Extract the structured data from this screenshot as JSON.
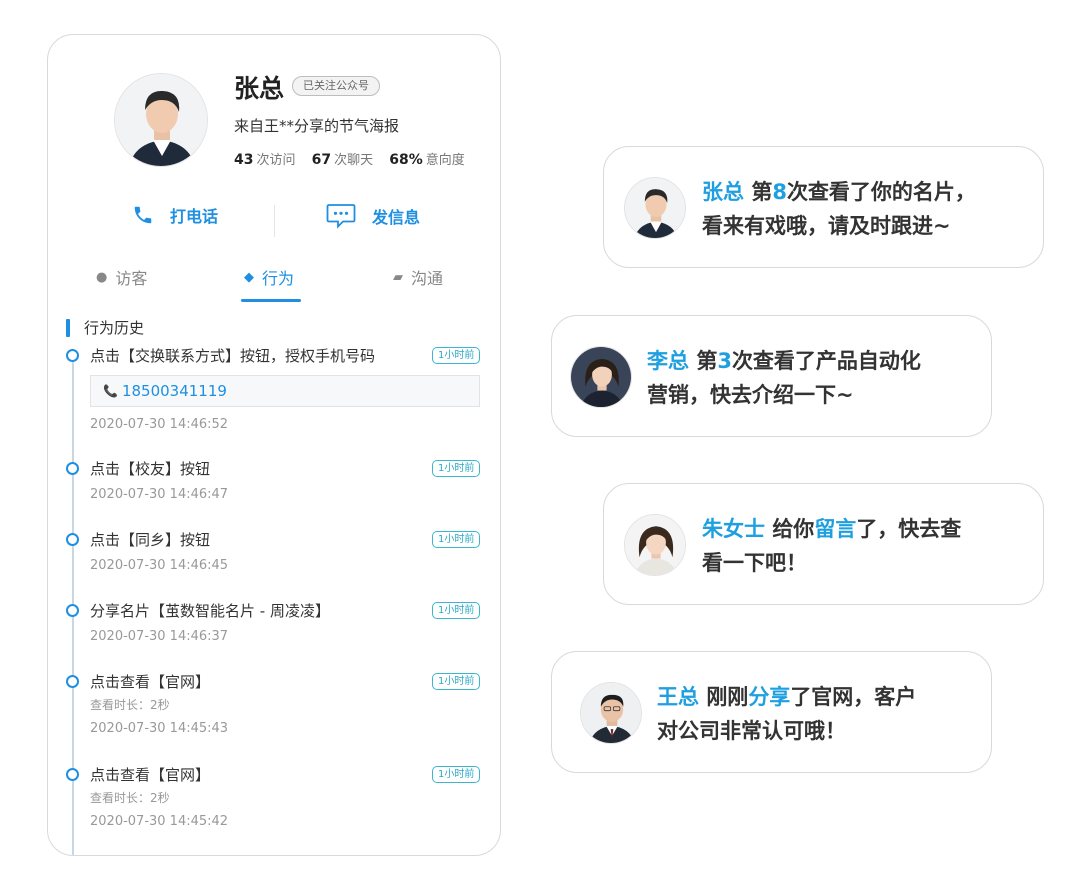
{
  "profile": {
    "name": "张总",
    "follow_badge": "已关注公众号",
    "source": "来自王**分享的节气海报",
    "visits_value": "43",
    "visits_label": "次访问",
    "chats_value": "67",
    "chats_label": "次聊天",
    "intent_value": "68%",
    "intent_label": "意向度"
  },
  "actions": {
    "call_label": "打电话",
    "message_label": "发信息"
  },
  "tabs": [
    {
      "label": "访客"
    },
    {
      "label": "行为"
    },
    {
      "label": "沟通"
    }
  ],
  "active_tab": "行为",
  "section_title": "行为历史",
  "events": [
    {
      "title": "点击【交换联系方式】按钮，授权手机号码",
      "badge": "1小时前",
      "phone": "18500341119",
      "time": "2020-07-30 14:46:52"
    },
    {
      "title": "点击【校友】按钮",
      "badge": "1小时前",
      "time": "2020-07-30 14:46:47"
    },
    {
      "title": "点击【同乡】按钮",
      "badge": "1小时前",
      "time": "2020-07-30 14:46:45"
    },
    {
      "title": "分享名片【茧数智能名片 - 周凌凌】",
      "badge": "1小时前",
      "time": "2020-07-30 14:46:37"
    },
    {
      "title": "点击查看【官网】",
      "badge": "1小时前",
      "sub": "查看时长：2秒",
      "time": "2020-07-30 14:45:43"
    },
    {
      "title": "点击查看【官网】",
      "badge": "1小时前",
      "sub": "查看时长：2秒",
      "time": "2020-07-30 14:45:42"
    }
  ],
  "notifications": [
    {
      "name": "张总",
      "line1_a": "第",
      "line1_hl": "8",
      "line1_b": "次查看了你的名片，",
      "line2": "看来有戏哦，请及时跟进~"
    },
    {
      "name": "李总",
      "line1_a": "第",
      "line1_hl": "3",
      "line1_b": "次查看了产品自动化",
      "line2": "营销，快去介绍一下~"
    },
    {
      "name": "朱女士",
      "line1_a": "给你",
      "line1_hl": "留言",
      "line1_b": "了，快去查",
      "line2": "看一下吧！"
    },
    {
      "name": "王总",
      "line1_a": "刚刚",
      "line1_hl": "分享",
      "line1_b": "了官网，客户",
      "line2": "对公司非常认可哦！"
    }
  ],
  "colors": {
    "accent": "#1e8fe1",
    "badge": "#2aa8c4",
    "highlight": "#1d9fe0"
  }
}
